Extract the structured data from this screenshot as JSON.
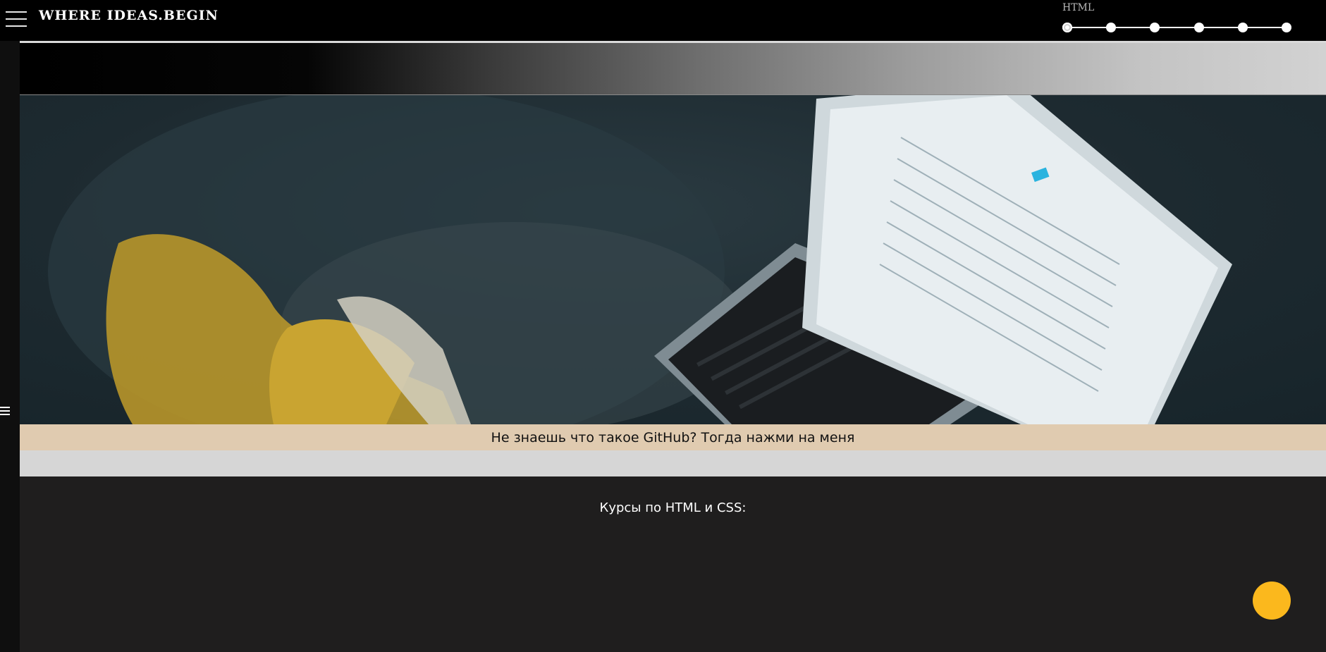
{
  "header": {
    "brand": "WHERE IDEAS.BEGIN",
    "menu_icon": "hamburger-icon",
    "progress": {
      "label": "HTML",
      "steps": 6,
      "current_step": 1
    }
  },
  "sidebar": {
    "icon": "hamburger-icon"
  },
  "banner": {
    "text": "Не знаешь что такое GitHub? Тогда нажми на меня"
  },
  "courses": {
    "title": "Курсы по HTML и CSS:"
  },
  "colors": {
    "accent": "#fbb81d",
    "banner_bg": "#e0cbb0",
    "page_bg": "#1f1e1e"
  }
}
